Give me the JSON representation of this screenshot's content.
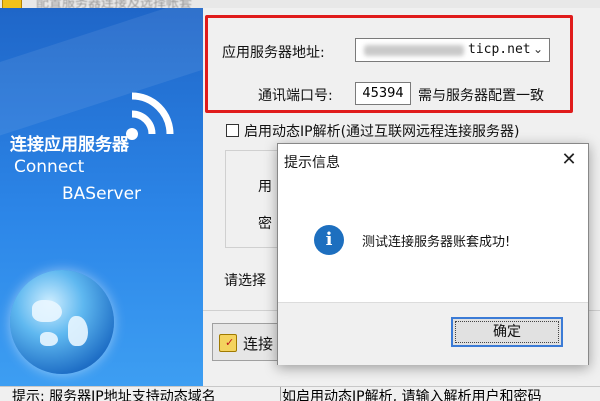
{
  "window": {
    "title": "配置服务器连接及选择帐套"
  },
  "banner": {
    "title_cn": "连接应用服务器",
    "title_en_1": "Connect",
    "title_en_2": "BAServer",
    "wifi_icon": "wifi-icon",
    "globe_icon": "globe-icon"
  },
  "form": {
    "server_label": "应用服务器地址:",
    "server_value": "ticp.net",
    "port_label": "通讯端口号:",
    "port_value": "45394",
    "port_hint": "需与服务器配置一致",
    "dynamic_ip_label": "启用动态IP解析(通过互联网远程连接服务器)",
    "dynamic_ip_checked": false,
    "user_label": "用",
    "password_label": "密",
    "select_label": "请选择",
    "connect_button": "连接"
  },
  "status_bar": {
    "left": "提示: 服务器IP地址支持动态域名",
    "right": "如启用动态IP解析, 请输入解析用户和密码"
  },
  "dialog": {
    "title": "提示信息",
    "message": "测试连接服务器账套成功!",
    "ok_button": "确定",
    "close_glyph": "✕",
    "info_glyph": "i"
  },
  "colors": {
    "banner_blue": "#2c86e8",
    "highlight_red": "#e01b1b",
    "info_blue": "#1d6fbf",
    "focus_blue": "#3b7bd6"
  }
}
